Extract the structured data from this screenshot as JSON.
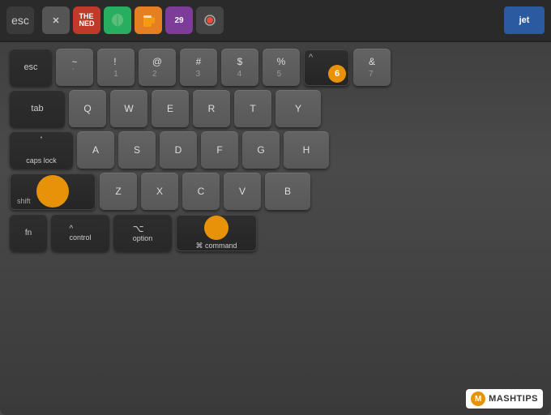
{
  "touchbar": {
    "esc": "esc",
    "icons": [
      {
        "name": "close",
        "symbol": "✕",
        "bg": "#555"
      },
      {
        "name": "ned",
        "symbol": "NE",
        "bg": "#c0392b"
      },
      {
        "name": "leaf",
        "symbol": "🌿",
        "bg": "#27ae60"
      },
      {
        "name": "beer",
        "symbol": "🍺",
        "bg": "#e67e22"
      },
      {
        "name": "timing",
        "symbol": "29",
        "bg": "#7d3c98"
      },
      {
        "name": "record",
        "symbol": "⏺",
        "bg": "#555"
      },
      {
        "name": "jet",
        "symbol": "jet",
        "bg": "#2c5aa0"
      }
    ]
  },
  "rows": {
    "row1": {
      "keys": [
        "~\n`",
        "!\n1",
        "@\n2",
        "#\n3",
        "$\n4",
        "%\n5",
        "6",
        "&\n7"
      ]
    },
    "row2": {
      "label": "tab",
      "keys": [
        "Q",
        "W",
        "E",
        "R",
        "T",
        "Y"
      ]
    },
    "row3": {
      "label": "caps lock",
      "keys": [
        "A",
        "S",
        "D",
        "F",
        "G",
        "H"
      ]
    },
    "row4": {
      "label": "shift",
      "keys": [
        "Z",
        "X",
        "C",
        "V",
        "B"
      ]
    },
    "row5": {
      "keys": [
        "fn",
        "control",
        "option",
        "command"
      ]
    }
  },
  "watermark": {
    "m": "M",
    "text": "MASHTIPS"
  },
  "accent_color": "#e8920a"
}
